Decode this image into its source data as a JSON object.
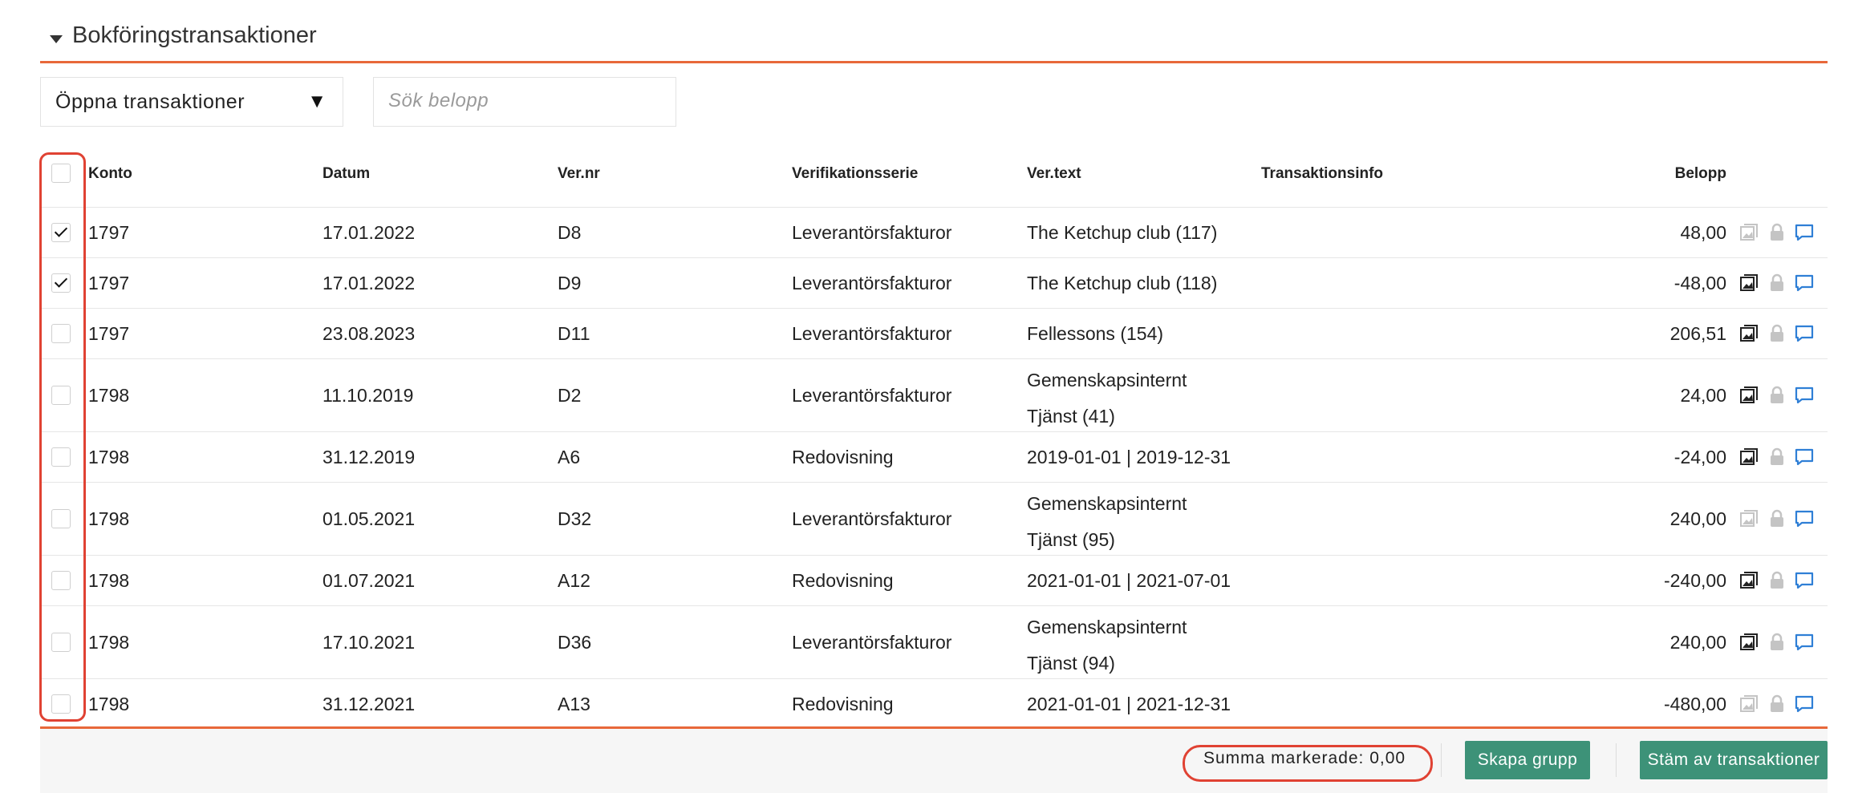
{
  "section": {
    "title": "Bokföringstransaktioner"
  },
  "filter": {
    "selected": "Öppna transaktioner",
    "arrow": "▼"
  },
  "search": {
    "placeholder": "Sök belopp",
    "value": ""
  },
  "columns": {
    "konto": "Konto",
    "datum": "Datum",
    "vernr": "Ver.nr",
    "serie": "Verifikationsserie",
    "vtext": "Ver.text",
    "info": "Transaktionsinfo",
    "belopp": "Belopp"
  },
  "rows": [
    {
      "checked": true,
      "konto": "1797",
      "datum": "17.01.2022",
      "vernr": "D8",
      "serie": "Leverantörsfakturor",
      "vtext": "The Ketchup club (117)",
      "belopp": "48,00",
      "attachment_active": false
    },
    {
      "checked": true,
      "konto": "1797",
      "datum": "17.01.2022",
      "vernr": "D9",
      "serie": "Leverantörsfakturor",
      "vtext": "The Ketchup club (118)",
      "belopp": "-48,00",
      "attachment_active": true
    },
    {
      "checked": false,
      "konto": "1797",
      "datum": "23.08.2023",
      "vernr": "D11",
      "serie": "Leverantörsfakturor",
      "vtext": "Fellessons (154)",
      "belopp": "206,51",
      "attachment_active": true
    },
    {
      "checked": false,
      "konto": "1798",
      "datum": "11.10.2019",
      "vernr": "D2",
      "serie": "Leverantörsfakturor",
      "vtext": "Gemenskapsinternt Tjänst (41)",
      "belopp": "24,00",
      "attachment_active": true
    },
    {
      "checked": false,
      "konto": "1798",
      "datum": "31.12.2019",
      "vernr": "A6",
      "serie": "Redovisning",
      "vtext": "2019-01-01 | 2019-12-31",
      "belopp": "-24,00",
      "attachment_active": true
    },
    {
      "checked": false,
      "konto": "1798",
      "datum": "01.05.2021",
      "vernr": "D32",
      "serie": "Leverantörsfakturor",
      "vtext": "Gemenskapsinternt Tjänst (95)",
      "belopp": "240,00",
      "attachment_active": false
    },
    {
      "checked": false,
      "konto": "1798",
      "datum": "01.07.2021",
      "vernr": "A12",
      "serie": "Redovisning",
      "vtext": "2021-01-01 | 2021-07-01",
      "belopp": "-240,00",
      "attachment_active": true
    },
    {
      "checked": false,
      "konto": "1798",
      "datum": "17.10.2021",
      "vernr": "D36",
      "serie": "Leverantörsfakturor",
      "vtext": "Gemenskapsinternt Tjänst (94)",
      "belopp": "240,00",
      "attachment_active": true
    },
    {
      "checked": false,
      "konto": "1798",
      "datum": "31.12.2021",
      "vernr": "A13",
      "serie": "Redovisning",
      "vtext": "2021-01-01 | 2021-12-31",
      "belopp": "-480,00",
      "attachment_active": false
    }
  ],
  "row_icons": [
    "image-attachment-icon",
    "lock-icon",
    "comment-icon"
  ],
  "footer": {
    "sum_label": "Summa markerade: 0,00",
    "create_group": "Skapa grupp",
    "reconcile": "Stäm av transaktioner"
  },
  "colors": {
    "accent_line": "#e8683a",
    "highlight": "#e04233",
    "button": "#3d9278",
    "comment_icon": "#2f7fd6",
    "icon_muted": "#c4c4c4",
    "icon_active": "#222222"
  }
}
